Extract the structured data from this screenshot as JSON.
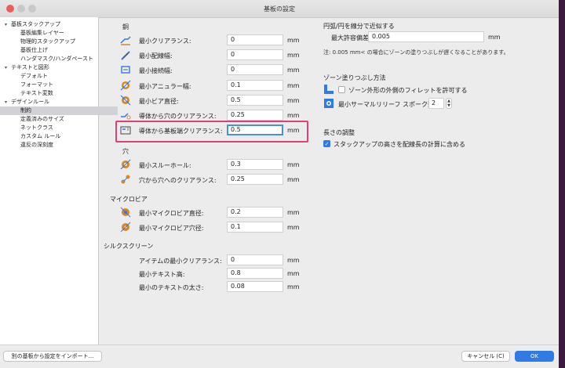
{
  "window": {
    "title": "基板の設定"
  },
  "sidebar": {
    "items": [
      {
        "label": "基板スタックアップ",
        "indent": 0,
        "expanded": true
      },
      {
        "label": "基板編集レイヤー",
        "indent": 1
      },
      {
        "label": "物理的スタックアップ",
        "indent": 1
      },
      {
        "label": "基板仕上げ",
        "indent": 1
      },
      {
        "label": "ハンダマスク/ハンダペースト",
        "indent": 1
      },
      {
        "label": "テキストと図形",
        "indent": 0,
        "expanded": true
      },
      {
        "label": "デフォルト",
        "indent": 1
      },
      {
        "label": "フォーマット",
        "indent": 1
      },
      {
        "label": "テキスト変数",
        "indent": 1
      },
      {
        "label": "デザインルール",
        "indent": 0,
        "expanded": true
      },
      {
        "label": "制約",
        "indent": 1,
        "selected": true
      },
      {
        "label": "定義済みのサイズ",
        "indent": 1
      },
      {
        "label": "ネットクラス",
        "indent": 1
      },
      {
        "label": "カスタム ルール",
        "indent": 1
      },
      {
        "label": "違反の深刻度",
        "indent": 1
      }
    ]
  },
  "copper": {
    "heading": "銅",
    "rows": [
      {
        "icon": "clearance-icon",
        "label": "最小クリアランス:",
        "value": "0",
        "unit": "mm"
      },
      {
        "icon": "track-width-icon",
        "label": "最小配線幅:",
        "value": "0",
        "unit": "mm"
      },
      {
        "icon": "connection-width-icon",
        "label": "最小接続幅:",
        "value": "0",
        "unit": "mm"
      },
      {
        "icon": "annular-width-icon",
        "label": "最小アニュラー幅:",
        "value": "0.1",
        "unit": "mm"
      },
      {
        "icon": "via-diameter-icon",
        "label": "最小ビア直径:",
        "value": "0.5",
        "unit": "mm"
      },
      {
        "icon": "hole-clearance-icon",
        "label": "導体から穴のクリアランス:",
        "value": "0.25",
        "unit": "mm"
      },
      {
        "icon": "edge-clearance-icon",
        "label": "導体から基板端クリアランス:",
        "value": "0.5",
        "unit": "mm",
        "focused": true
      }
    ]
  },
  "holes": {
    "heading": "穴",
    "rows": [
      {
        "icon": "through-hole-icon",
        "label": "最小スルーホール:",
        "value": "0.3",
        "unit": "mm"
      },
      {
        "icon": "hole-to-hole-icon",
        "label": "穴から穴へのクリアランス:",
        "value": "0.25",
        "unit": "mm"
      }
    ]
  },
  "microvias": {
    "heading": "マイクロビア",
    "rows": [
      {
        "icon": "microvia-diameter-icon",
        "label": "最小マイクロビア直径:",
        "value": "0.2",
        "unit": "mm"
      },
      {
        "icon": "microvia-hole-icon",
        "label": "最小マイクロビア穴径:",
        "value": "0.1",
        "unit": "mm"
      }
    ]
  },
  "silkscreen": {
    "heading": "シルクスクリーン",
    "rows": [
      {
        "label": "アイテムの最小クリアランス:",
        "value": "0",
        "unit": "mm"
      },
      {
        "label": "最小テキスト高:",
        "value": "0.8",
        "unit": "mm"
      },
      {
        "label": "最小のテキストの太さ:",
        "value": "0.08",
        "unit": "mm"
      }
    ]
  },
  "arcs": {
    "heading": "円弧/円を線分で近似する",
    "max_error_label": "最大許容偏差:",
    "max_error_value": "0.005",
    "unit": "mm",
    "note": "注: 0.005 mm< の場合にゾーンの塗りつぶしが遅くなることがあります。"
  },
  "zone_fill": {
    "heading": "ゾーン塗りつぶし方法",
    "fillet_label": "ゾーン外形の外側のフィレットを許可する",
    "fillet_checked": false,
    "spokes_label": "最小サーマルリリーフ スポーク数:",
    "spokes_value": "2"
  },
  "length_tuning": {
    "heading": "長さの調整",
    "stackup_label": "スタックアップの高さを配線長の計算に含める",
    "stackup_checked": true
  },
  "footer": {
    "import_label": "別の基板から設定をインポート...",
    "cancel_label": "キャンセル (C)",
    "ok_label": "OK"
  },
  "colors": {
    "accent": "#2f7ae5",
    "highlight": "#e0407a"
  }
}
